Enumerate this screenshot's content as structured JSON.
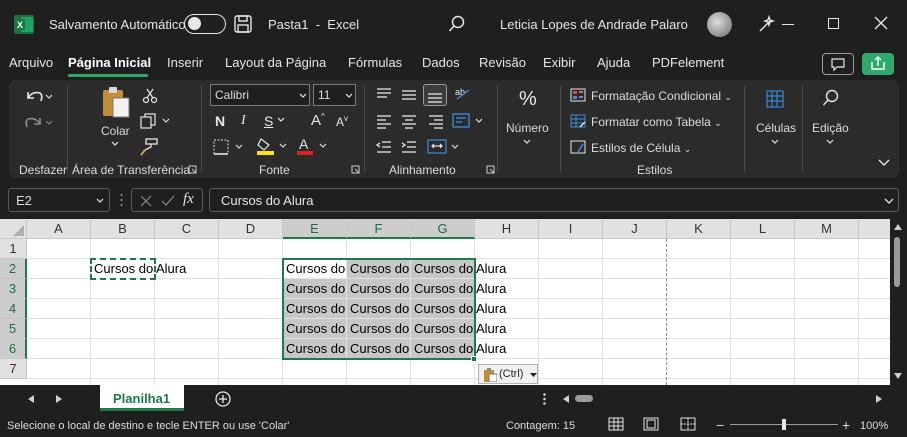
{
  "titlebar": {
    "autosave_label": "Salvamento Automático",
    "toggle_state": "Desativado",
    "doc_title": "Pasta1",
    "separator": "-",
    "app_name": "Excel",
    "user_name": "Leticia Lopes de Andrade Palaro"
  },
  "menu": {
    "tabs": [
      {
        "label": "Arquivo"
      },
      {
        "label": "Página Inicial",
        "active": true
      },
      {
        "label": "Inserir"
      },
      {
        "label": "Layout da Página"
      },
      {
        "label": "Fórmulas"
      },
      {
        "label": "Dados"
      },
      {
        "label": "Revisão"
      },
      {
        "label": "Exibir"
      },
      {
        "label": "Ajuda"
      },
      {
        "label": "PDFelement"
      }
    ]
  },
  "ribbon": {
    "groups": {
      "undo": "Desfazer",
      "clipboard": "Área de Transferência",
      "font": "Fonte",
      "alignment": "Alinhamento",
      "styles": "Estilos"
    },
    "paste_label": "Colar",
    "font_name": "Calibri",
    "font_size": "11",
    "bold": "N",
    "italic": "I",
    "underline": "S",
    "grow_font": "A",
    "shrink_font": "A",
    "number_label": "Número",
    "conditional_formatting": "Formatação Condicional",
    "format_as_table": "Formatar como Tabela",
    "cell_styles": "Estilos de Célula",
    "cells_label": "Células",
    "editing_label": "Edição"
  },
  "formula_bar": {
    "name_box": "E2",
    "fx": "fx",
    "content": "Cursos do Alura"
  },
  "sheet": {
    "columns": [
      "A",
      "B",
      "C",
      "D",
      "E",
      "F",
      "G",
      "H",
      "I",
      "J",
      "K",
      "L",
      "M"
    ],
    "rows": [
      "1",
      "2",
      "3",
      "4",
      "5",
      "6",
      "7"
    ],
    "cells": {
      "B2": "Cursos do Alura",
      "E2": "Cursos do Alura",
      "F2": "Cursos do Alura",
      "G2": "Cursos do Alura",
      "E3": "Cursos do Alura",
      "F3": "Cursos do Alura",
      "G3": "Cursos do Alura",
      "E4": "Cursos do Alura",
      "F4": "Cursos do Alura",
      "G4": "Cursos do Alura",
      "E5": "Cursos do Alura",
      "F5": "Cursos do Alura",
      "G5": "Cursos do Alura",
      "E6": "Cursos do Alura",
      "F6": "Cursos do Alura",
      "G6": "Cursos do Alura"
    },
    "overflow": {
      "B2": "Alura",
      "G2": "Alura",
      "G3": "Alura",
      "G4": "Alura",
      "G5": "Alura",
      "G6": "Alura"
    },
    "paste_options": "(Ctrl)"
  },
  "sheets": {
    "tabs": [
      "Planilha1"
    ],
    "active": "Planilha1"
  },
  "status_bar": {
    "message": "Selecione o local de destino e tecle ENTER ou use 'Colar'",
    "count": "Contagem: 15",
    "zoom": "100%",
    "zoom_value": 100,
    "zoom_minus": "−",
    "zoom_plus": "+"
  },
  "colors": {
    "accent": "#2ea86b",
    "selection_border": "#1f7a48",
    "selection_fill": "#c7c7c7",
    "font_color_bar": "#e02020",
    "highlight_bar": "#ffe600"
  }
}
